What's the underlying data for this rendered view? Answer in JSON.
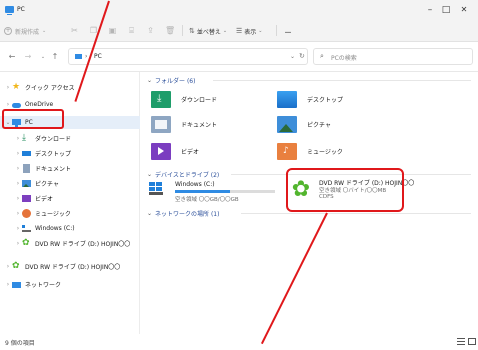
{
  "window": {
    "title": "PC",
    "controls": {
      "minimize": "–",
      "maximize": "□",
      "close": "✕"
    }
  },
  "toolbar": {
    "new_label": "新規作成",
    "sort_label": "並べ替え",
    "view_label": "表示",
    "more_label": "…"
  },
  "address": {
    "location": "PC",
    "search_placeholder": "PCの検索"
  },
  "sidebar": {
    "items": [
      {
        "label": "クイック アクセス"
      },
      {
        "label": "OneDrive"
      },
      {
        "label": "PC"
      },
      {
        "label": "ダウンロード"
      },
      {
        "label": "デスクトップ"
      },
      {
        "label": "ドキュメント"
      },
      {
        "label": "ピクチャ"
      },
      {
        "label": "ビデオ"
      },
      {
        "label": "ミュージック"
      },
      {
        "label": "Windows (C:)"
      },
      {
        "label": "DVD RW ドライブ (D:) HOJIN〇〇"
      },
      {
        "label": "DVD RW ドライブ (D:) HOJIN〇〇"
      },
      {
        "label": "ネットワーク"
      }
    ]
  },
  "content": {
    "folders_header": "フォルダー (6)",
    "folders": [
      {
        "label": "ダウンロード"
      },
      {
        "label": "デスクトップ"
      },
      {
        "label": "ドキュメント"
      },
      {
        "label": "ピクチャ"
      },
      {
        "label": "ビデオ"
      },
      {
        "label": "ミュージック"
      }
    ],
    "drives_header": "デバイスとドライブ (2)",
    "drive_c": {
      "name": "Windows (C:)",
      "free": "空き領域 〇〇GB/〇〇GB",
      "used_fraction": 0.55
    },
    "drive_d": {
      "name": "DVD RW ドライブ (D:) HOJIN〇〇",
      "free": "空き領域 〇バイト/〇〇MB",
      "fs": "CDFS"
    },
    "network_header": "ネットワークの場所 (1)"
  },
  "status": {
    "item_count": "9 個の項目"
  },
  "colors": {
    "accent": "#2f8be3",
    "annotation_red": "#e0181b",
    "selected_bg": "#e5eef9"
  }
}
